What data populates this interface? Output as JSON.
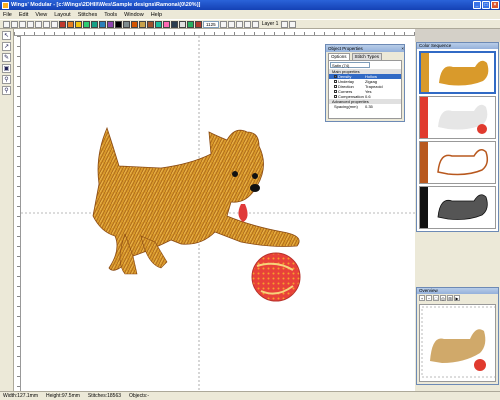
{
  "window": {
    "title": "Wings' Modular - [c:\\Wings\\2DHII\\\\Wes\\Sample designs\\Ramona\\(0\\20%)]",
    "buttons": [
      "_",
      "□",
      "×"
    ]
  },
  "menu": [
    "File",
    "Edit",
    "View",
    "Layout",
    "Stitches",
    "Tools",
    "Window",
    "Help"
  ],
  "toolbar": {
    "colors": [
      "#c0392b",
      "#e67e22",
      "#f1c40f",
      "#2ecc71",
      "#16a085",
      "#2980b9",
      "#8e44ad",
      "#000000",
      "#7f8c8d",
      "#d35400",
      "#c8a24a",
      "#a0522d",
      "#1abc9c",
      "#ff69b4",
      "#2c3e50",
      "#e0e0e0",
      "#27ae60",
      "#b03a2e"
    ],
    "zoom": "1125",
    "layer_label": "Layer 1"
  },
  "left_tools": [
    "↖",
    "↗",
    "✎",
    "▣",
    "⚲",
    "⚲"
  ],
  "object_properties": {
    "title": "Object Properties",
    "tabs": [
      "Options",
      "Stitch Types"
    ],
    "combo": "Satin (74)",
    "group_header": "Main properties",
    "rows": [
      {
        "k": "Density",
        "v": "Hollow"
      },
      {
        "k": "Underlay",
        "v": "Zigzag"
      },
      {
        "k": "Direction",
        "v": "Trapezoid"
      },
      {
        "k": "Corners",
        "v": "Yes"
      },
      {
        "k": "Compensation",
        "v": "0.6"
      }
    ],
    "group2": "Advanced properties",
    "last_row": {
      "k": "Spacing(mm)",
      "v": "0.35"
    }
  },
  "color_sequence": {
    "title": "Color Sequence"
  },
  "overview": {
    "title": "Overview",
    "tools": [
      "+",
      "−",
      "□",
      "◎",
      "⊞",
      "▶"
    ]
  },
  "status": [
    "Width:127.1mm",
    "Height:97.5mm",
    "Stitches:18563",
    "Objects:-"
  ]
}
